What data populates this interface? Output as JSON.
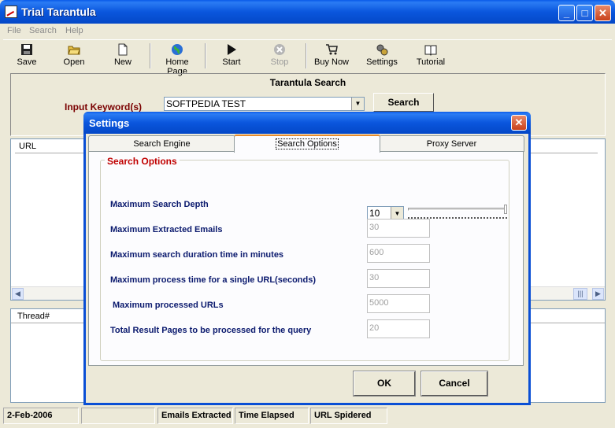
{
  "window": {
    "title": "Trial Tarantula"
  },
  "menu": [
    "File",
    "Search",
    "Help"
  ],
  "toolbar": {
    "save": "Save",
    "open": "Open",
    "new": "New",
    "home": "Home Page",
    "start": "Start",
    "stop": "Stop",
    "buy": "Buy Now",
    "settings": "Settings",
    "tutorial": "Tutorial"
  },
  "search_panel": {
    "heading": "Tarantula Search",
    "keyword_label": "Input Keyword(s)",
    "keyword_value": "SOFTPEDIA TEST",
    "search_button": "Search"
  },
  "url_list": {
    "column": "URL"
  },
  "thread_list": {
    "column": "Thread#"
  },
  "status": {
    "date": "2-Feb-2006",
    "empty": "",
    "emails": "Emails Extracted",
    "elapsed": "Time Elapsed",
    "spidered": "URL Spidered"
  },
  "dialog": {
    "title": "Settings",
    "tabs": [
      "Search Engine",
      "Search Options",
      "Proxy Server"
    ],
    "active_tab": "Search Options",
    "group_title": "Search Options",
    "rows": [
      {
        "label": "Maximum Search Depth",
        "value": "10"
      },
      {
        "label": "Maximum Extracted Emails",
        "value": "30"
      },
      {
        "label": "Maximum search duration time in minutes",
        "value": "600"
      },
      {
        "label": "Maximum process time for a single URL(seconds)",
        "value": "30"
      },
      {
        "label": "Maximum processed URLs",
        "value": "5000"
      },
      {
        "label": "Total Result Pages to be processed for the query",
        "value": "20"
      }
    ],
    "ok": "OK",
    "cancel": "Cancel"
  }
}
